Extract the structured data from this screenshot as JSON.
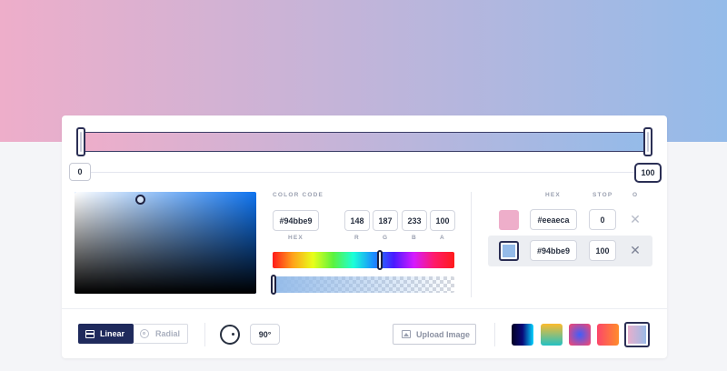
{
  "colors": {
    "accent": "#1f2a5c",
    "stop_start": "#eeaeca",
    "stop_end": "#94bbe9",
    "hue": "#0f74f0"
  },
  "gradient": {
    "mode": "linear",
    "angle_deg": 90,
    "stops": [
      {
        "hex": "#eeaeca",
        "position": 0,
        "selected": false
      },
      {
        "hex": "#94bbe9",
        "position": 100,
        "selected": true
      }
    ]
  },
  "track": {
    "min_label": "0",
    "max_label": "100"
  },
  "color_code": {
    "section_label": "COLOR CODE",
    "hex_value": "#94bbe9",
    "r_value": "148",
    "g_value": "187",
    "b_value": "233",
    "a_value": "100",
    "hex_label": "HEX",
    "r_label": "R",
    "g_label": "G",
    "b_label": "B",
    "a_label": "A",
    "hue_slider_percent": 59,
    "alpha_slider_percent": 0
  },
  "stops_list": {
    "hex_header": "HEX",
    "stop_header": "STOP",
    "extra_header": "O",
    "rows": [
      {
        "hex": "#eeaeca",
        "stop": "0",
        "remove_icon": "close-icon"
      },
      {
        "hex": "#94bbe9",
        "stop": "100",
        "remove_icon": "close-icon"
      }
    ]
  },
  "toolbar": {
    "linear_label": "Linear",
    "radial_label": "Radial",
    "angle_label": "90°",
    "upload_label": "Upload Image",
    "linear_icon": "linear-mode-icon",
    "radial_icon": "radial-mode-icon",
    "angle_icon": "angle-dial-icon",
    "upload_icon": "image-icon"
  },
  "presets": [
    {
      "gradient": "linear-gradient(90deg, #020024, #090979, #00d4ff)",
      "selected": false
    },
    {
      "gradient": "linear-gradient(0deg, #22c1c3, #fdbb2d)",
      "selected": false
    },
    {
      "gradient": "radial-gradient(circle, #3f5efb, #fc466b)",
      "selected": false
    },
    {
      "gradient": "linear-gradient(90deg, #fc466b, #ff8c2b)",
      "selected": false
    },
    {
      "gradient": "linear-gradient(90deg, #eeaeca, #94bbe9)",
      "selected": true
    }
  ]
}
